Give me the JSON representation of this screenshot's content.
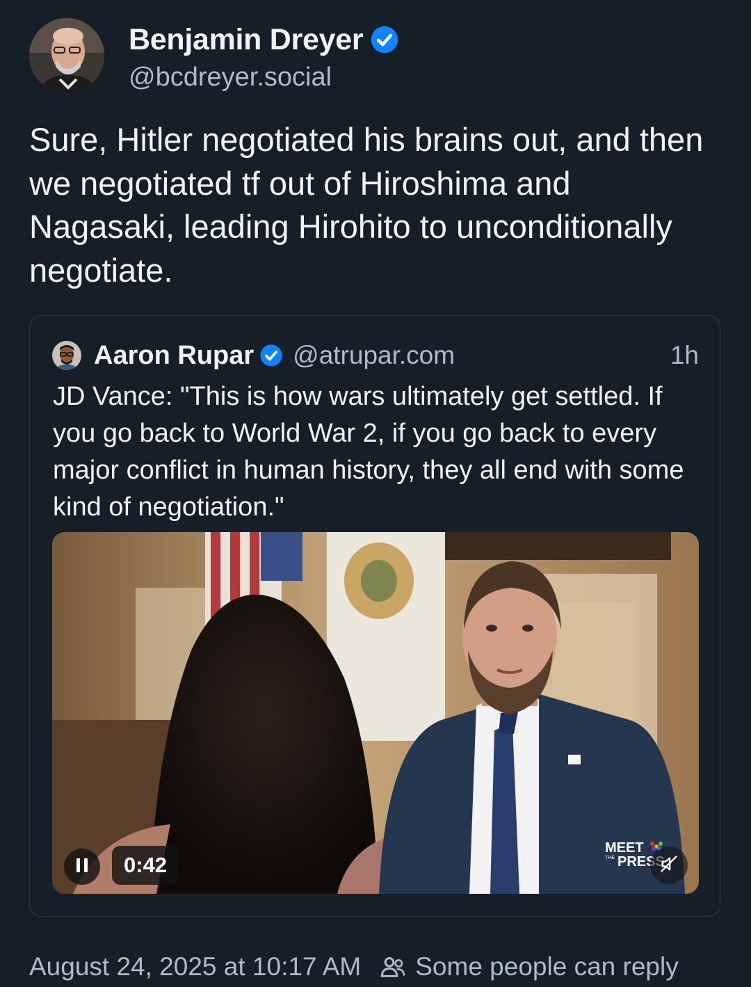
{
  "post": {
    "author": {
      "display_name": "Benjamin Dreyer",
      "handle": "@bcdreyer.social",
      "verified_icon": "verified-check-icon"
    },
    "text": "Sure, Hitler negotiated his brains out, and then we negotiated tf out of Hiroshima and Nagasaki, leading Hirohito to unconditionally negotiate.",
    "timestamp": "August 24, 2025 at 10:17 AM",
    "reply_setting": "Some people can reply",
    "reply_setting_icon": "people-icon"
  },
  "quote": {
    "author": {
      "display_name": "Aaron Rupar",
      "handle": "@atrupar.com",
      "verified_icon": "verified-check-icon"
    },
    "time": "1h",
    "text": "JD Vance: \"This is how wars ultimately get settled. If you go back to World War 2, if you go back to every major conflict in human history, they all end with some kind of negotiation.\"",
    "video": {
      "duration": "0:42",
      "state": "playing",
      "muted": true,
      "watermark": "MEET THE PRESS"
    }
  },
  "colors": {
    "background": "#161e27",
    "text_primary": "#f1f3f5",
    "text_secondary": "#aebbc9",
    "verified_blue": "#1083fe",
    "quote_border": "#2e3a48"
  }
}
